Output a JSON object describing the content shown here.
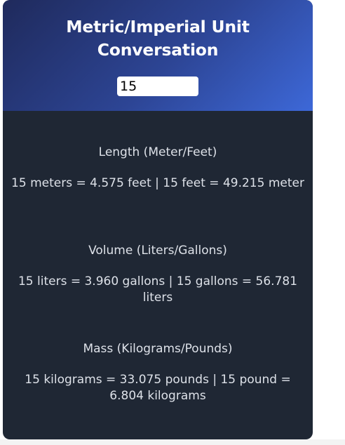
{
  "header": {
    "title_line1": "Metric/Imperial Unit",
    "title_line2": "Conversation"
  },
  "input": {
    "value": "15"
  },
  "sections": [
    {
      "heading": "Length (Meter/Feet)",
      "result": "15 meters = 4.575 feet | 15 feet = 49.215 meter"
    },
    {
      "heading": "Volume (Liters/Gallons)",
      "result": "15 liters = 3.960 gallons | 15 gallons = 56.781 liters"
    },
    {
      "heading": "Mass (Kilograms/Pounds)",
      "result": "15 kilograms = 33.075 pounds | 15 pound = 6.804 kilograms"
    }
  ],
  "colors": {
    "header_gradient_start": "#1f2a5c",
    "header_gradient_end": "#3d68d8",
    "panel_background": "#1f2734",
    "text": "#dde1e8"
  }
}
